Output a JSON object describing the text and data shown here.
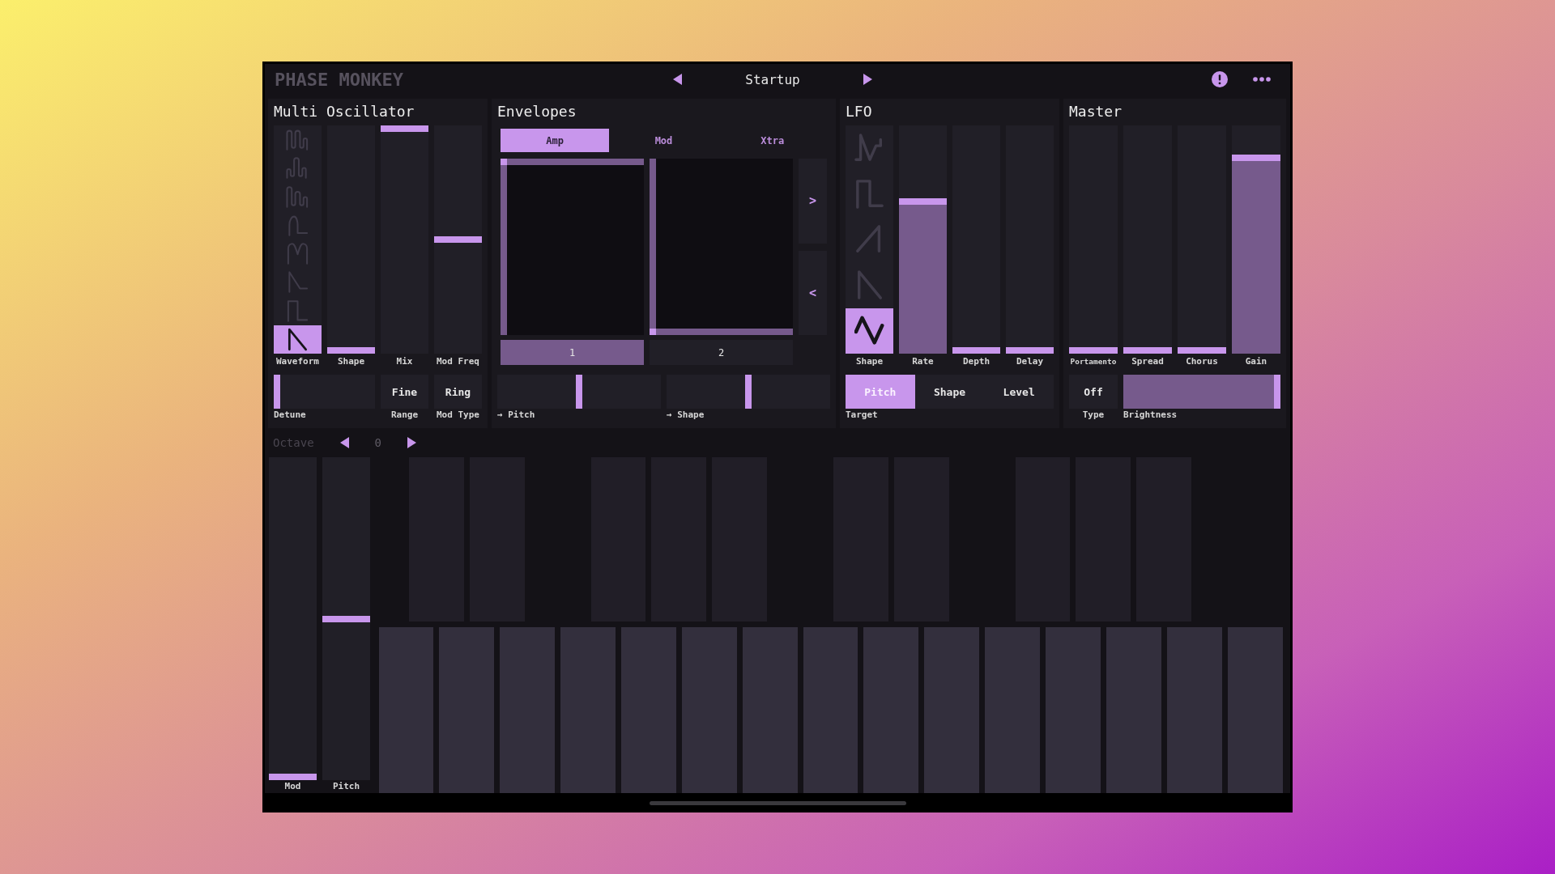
{
  "header": {
    "title": "PHASE MONKEY",
    "preset": "Startup"
  },
  "oscillator": {
    "title": "Multi Oscillator",
    "waveform": {
      "label": "Waveform",
      "options": [
        {
          "kind": "harmonics",
          "selected": false
        },
        {
          "kind": "formant",
          "selected": false
        },
        {
          "kind": "pulses",
          "selected": false
        },
        {
          "kind": "bump",
          "selected": false
        },
        {
          "kind": "double",
          "selected": false
        },
        {
          "kind": "decay",
          "selected": false
        },
        {
          "kind": "square",
          "selected": false
        },
        {
          "kind": "saw",
          "selected": true
        }
      ]
    },
    "sliders": [
      {
        "label": "Shape",
        "level": 0
      },
      {
        "label": "Mix",
        "filled": false,
        "level": 1
      },
      {
        "label": "Mod Freq",
        "filled": false,
        "level": 0.5
      }
    ],
    "controls": [
      {
        "kind": "hslider",
        "label": "Detune",
        "level": 0
      },
      {
        "kind": "button",
        "label": "Range",
        "value": "Fine"
      },
      {
        "kind": "button",
        "label": "Mod Type",
        "value": "Ring"
      }
    ]
  },
  "envelopes": {
    "title": "Envelopes",
    "tabs": [
      {
        "label": "Amp",
        "selected": true
      },
      {
        "label": "Mod",
        "selected": false
      },
      {
        "label": "Xtra",
        "selected": false
      }
    ],
    "pads": [
      {
        "label": "1",
        "selected": true,
        "level": 1
      },
      {
        "label": "2",
        "selected": false,
        "level": 0
      }
    ],
    "page_buttons": [
      ">",
      "<"
    ],
    "controls": [
      {
        "label": "→ Pitch",
        "filled": false,
        "level": 0.5
      },
      {
        "label": "→ Shape",
        "filled": false,
        "level": 0.5
      }
    ]
  },
  "lfo": {
    "title": "LFO",
    "shape": {
      "label": "Shape",
      "options": [
        {
          "kind": "random",
          "selected": false
        },
        {
          "kind": "square",
          "selected": false
        },
        {
          "kind": "ramp",
          "selected": false
        },
        {
          "kind": "saw",
          "selected": false
        },
        {
          "kind": "zigzag",
          "selected": true
        }
      ]
    },
    "sliders": [
      {
        "label": "Rate",
        "filled": true,
        "level": 0.67
      },
      {
        "label": "Depth",
        "level": 0
      },
      {
        "label": "Delay",
        "level": 0
      }
    ],
    "controls": [
      {
        "kind": "segmented",
        "label": "Target",
        "options": [
          {
            "label": "Pitch",
            "selected": true
          },
          {
            "label": "Shape",
            "selected": false
          },
          {
            "label": "Level",
            "selected": false
          }
        ]
      }
    ]
  },
  "master": {
    "title": "Master",
    "sliders": [
      {
        "label": "Portamento",
        "level": 0
      },
      {
        "label": "Spread",
        "level": 0
      },
      {
        "label": "Chorus",
        "level": 0
      },
      {
        "label": "Gain",
        "filled": true,
        "level": 0.87
      }
    ],
    "controls": [
      {
        "kind": "button",
        "label": "Type",
        "value": "Off"
      },
      {
        "kind": "hslider",
        "label": "Brightness",
        "filled": true,
        "level": 1
      }
    ]
  },
  "keyboard": {
    "octave": {
      "label": "Octave",
      "value": "0"
    },
    "wheels": [
      {
        "label": "Mod",
        "level": 0
      },
      {
        "label": "Pitch",
        "filled": false,
        "level": 0.5
      }
    ]
  }
}
